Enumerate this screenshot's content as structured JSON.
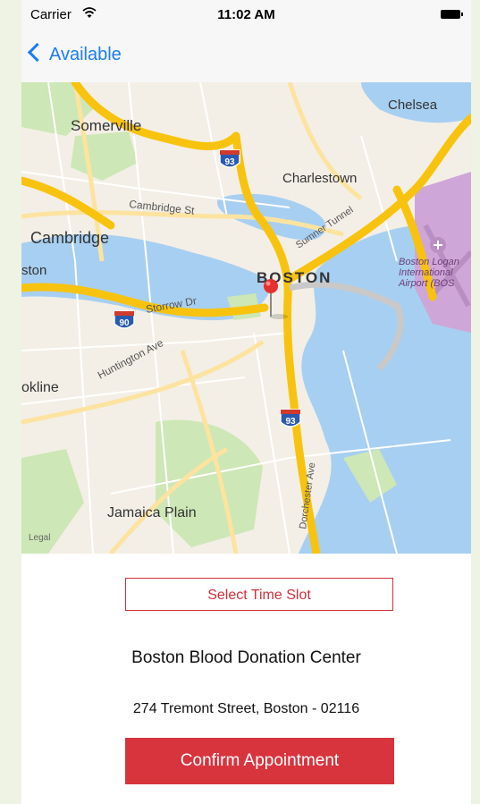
{
  "status_bar": {
    "carrier": "Carrier",
    "time": "11:02 AM"
  },
  "nav": {
    "back_label": "Available"
  },
  "map": {
    "labels": {
      "somerville": "Somerville",
      "chelsea": "Chelsea",
      "charlestown": "Charlestown",
      "cambridge_st": "Cambridge St",
      "cambridge": "Cambridge",
      "boston": "BOSTON",
      "ston": "ston",
      "sumner": "Sumner Tunnel",
      "airport1": "Boston Logan",
      "airport2": "International",
      "airport3": "Airport (BOS",
      "storrow": "Storrow Dr",
      "huntington": "Huntington Ave",
      "brookline": "okline",
      "jamaica": "Jamaica Plain",
      "dorchester": "Dorchester Ave",
      "legal": "Legal"
    },
    "shields": {
      "i93_north": "93",
      "i90": "90",
      "i93_south": "93"
    },
    "colors": {
      "water": "#a7cff1",
      "land": "#f3efe6",
      "park": "#cde7b6",
      "highway": "#f8c30f",
      "airport": "#cfa6d8"
    }
  },
  "appointment": {
    "select_slot_label": "Select Time Slot",
    "center_name": "Boston Blood Donation Center",
    "address": "274 Tremont Street, Boston - 02116",
    "confirm_label": "Confirm Appointment"
  }
}
